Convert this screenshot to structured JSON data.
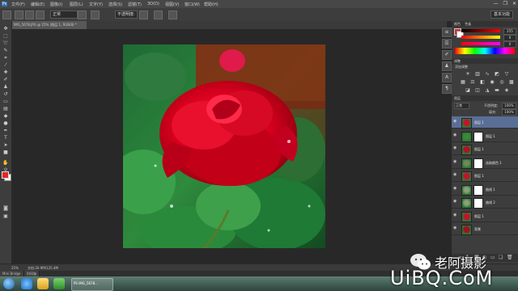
{
  "menubar": {
    "items": [
      "文件(F)",
      "编辑(E)",
      "图像(I)",
      "图层(L)",
      "文字(Y)",
      "选择(S)",
      "滤镜(T)",
      "3D(D)",
      "视图(V)",
      "窗口(W)",
      "帮助(H)"
    ],
    "window_controls": [
      "—",
      "❐",
      "✕"
    ]
  },
  "optionsbar": {
    "mode_value": "正常",
    "opacity_label": "不透明度:",
    "workspace_label": "基本功能"
  },
  "document": {
    "tab_label": "IMG_5678.JPG @ 25% (图层 1, RGB/8) *"
  },
  "status": {
    "zoom": "25%",
    "doc_info": "文档:20.9M/125.4M"
  },
  "mini_bridge": {
    "tabs": [
      "Mini Bridge",
      "时间轴"
    ]
  },
  "panels": {
    "color_tab": "颜色",
    "swatches_tab": "色板",
    "color_values": [
      "255",
      "0",
      "0"
    ],
    "adjustments_tab": "调整",
    "adjustments_title": "添加调整",
    "layers_tab": "图层",
    "blend_mode": "正常",
    "opacity_label": "不透明度:",
    "opacity_value": "100%",
    "fill_label": "填充:",
    "fill_value": "100%"
  },
  "layers": [
    {
      "name": "图层 1",
      "selected": true,
      "mask": false
    },
    {
      "name": "图层 1",
      "selected": false,
      "mask": true
    },
    {
      "name": "图层 1",
      "selected": false,
      "mask": false
    },
    {
      "name": "选取颜色 1",
      "selected": false,
      "mask": true
    },
    {
      "name": "图层 1",
      "selected": false,
      "mask": false
    },
    {
      "name": "曲线 1",
      "selected": false,
      "mask": true
    },
    {
      "name": "曲线 2",
      "selected": false,
      "mask": true
    },
    {
      "name": "图层 1",
      "selected": false,
      "mask": false
    },
    {
      "name": "背景",
      "selected": false,
      "mask": false
    }
  ],
  "taskbar": {
    "active_app_label": "PS IMG_5678..."
  },
  "watermark": {
    "cn": "老阿摄影",
    "url": "UiBQ.CoM"
  },
  "colors": {
    "foreground": "#e02828",
    "background": "#ffffff",
    "selected_layer": "#5a6f96"
  },
  "icons": [
    "move-icon",
    "marquee-icon",
    "lasso-icon",
    "quick-select-icon",
    "crop-icon",
    "eyedropper-icon",
    "healing-icon",
    "brush-icon",
    "stamp-icon",
    "history-brush-icon",
    "eraser-icon",
    "gradient-icon",
    "blur-icon",
    "dodge-icon",
    "pen-icon",
    "type-icon",
    "path-select-icon",
    "shape-icon",
    "hand-icon",
    "zoom-icon"
  ]
}
